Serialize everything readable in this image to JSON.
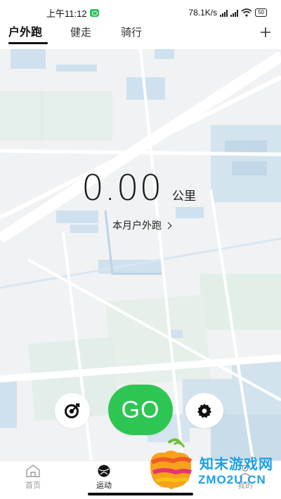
{
  "status_bar": {
    "time": "上午11:12",
    "network_speed": "78.1K/s",
    "battery": "50"
  },
  "tabs": [
    {
      "label": "户外跑",
      "active": true
    },
    {
      "label": "健走",
      "active": false
    },
    {
      "label": "骑行",
      "active": false
    }
  ],
  "summary": {
    "distance": "0.00",
    "unit": "公里",
    "period_link": "本月户外跑"
  },
  "actions": {
    "go_label": "GO",
    "go_color": "#2dc653"
  },
  "bottom_nav": [
    {
      "label": "首页",
      "icon": "home-icon",
      "active": false
    },
    {
      "label": "运动",
      "icon": "ball-icon",
      "active": true
    },
    {
      "label": "我的",
      "icon": "person-icon",
      "active": false
    }
  ],
  "watermark": {
    "line1": "知末游戏网",
    "line2": "ZMO2U.CN"
  }
}
